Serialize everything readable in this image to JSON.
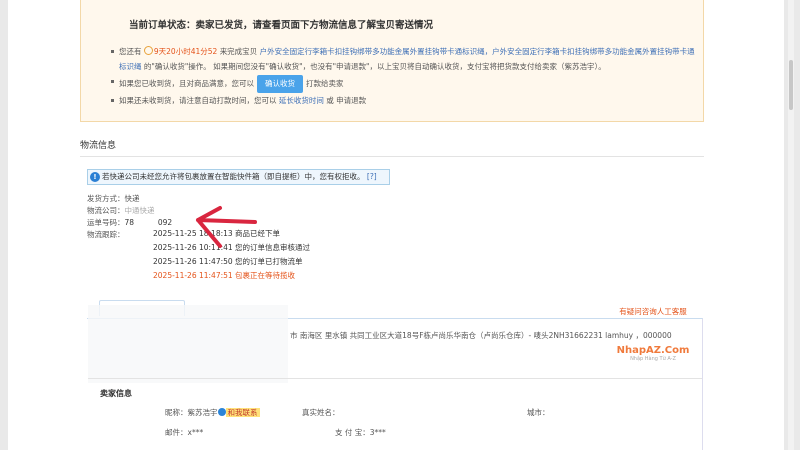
{
  "status": {
    "title": "当前订单状态：卖家已发货，请查看页面下方物流信息了解宝贝寄送情况",
    "line1_prefix": "您还有",
    "timer": "9天20小时41分52",
    "line1_mid": "来完成宝贝",
    "product_link": "户外安全固定行李箱卡扣挂钩绑带多功能金属外置挂钩带卡通标识绳，户外安全固定行李箱卡扣挂钩绑带多功能金属外置挂钩带卡通标识绳",
    "line1_suffix": "的\"确认收货\"操作。 如果期间您没有\"确认收货\"，也没有\"申请退款\"，以上宝贝将自动确认收货，支付宝将把货款支付给卖家（紫苏浩宇）。",
    "line2_prefix": "如果您已收到货，且对商品满意，您可以",
    "confirm_button": "确认收货",
    "line2_suffix": "打款给卖家",
    "line3_prefix": "如果还未收到货，请注意自动打款时间，您可以",
    "extend_link": "延长收货时间",
    "line3_or": "或",
    "refund_link": "申请退款"
  },
  "logistics": {
    "title": "物流信息",
    "notice": "若快递公司未经您允许将包裹放置在智能快件箱（即自提柜）中，您有权拒收。",
    "notice_help": "[?]",
    "ship_method_label": "发货方式：",
    "ship_method": "快递",
    "company_label": "物流公司：",
    "company": "中通快递",
    "tracking_label": "运单号码：",
    "tracking_no": "78          092",
    "track_label": "物流跟踪：",
    "events": [
      {
        "time": "2025-11-25 18:18:13",
        "text": "商品已经下单"
      },
      {
        "time": "2025-11-26 10:11:41",
        "text": "您的订单信息审核通过"
      },
      {
        "time": "2025-11-26 11:47:50",
        "text": "您的订单已打物流单"
      },
      {
        "time": "2025-11-26 11:47:51",
        "text": "包裹正在等待揽收"
      }
    ],
    "address": "市 南海区 里水镇 共同工业区大道18号F栋卢尚乐华南仓（卢尚乐仓库）- 唛头2NH31662231 lamhuy ，000000"
  },
  "watermark": {
    "help": "有疑问咨询人工客服",
    "logo": "NhapAZ.Com",
    "sub": "Nhập Hàng Từ A-Z"
  },
  "seller": {
    "title": "卖家信息",
    "nick_label": "昵称：",
    "nick": "紫苏浩宇",
    "contact": "和我联系",
    "realname_label": "真实姓名：",
    "city_label": "城市：",
    "email_label": "邮件：",
    "email": "x***",
    "alipay_label": "支 付 宝：",
    "alipay": "3***"
  },
  "colors": {
    "accent": "#e4541b",
    "link": "#3e6fb6",
    "button": "#4aa3ea",
    "annotation_arrow": "#d9263f"
  }
}
